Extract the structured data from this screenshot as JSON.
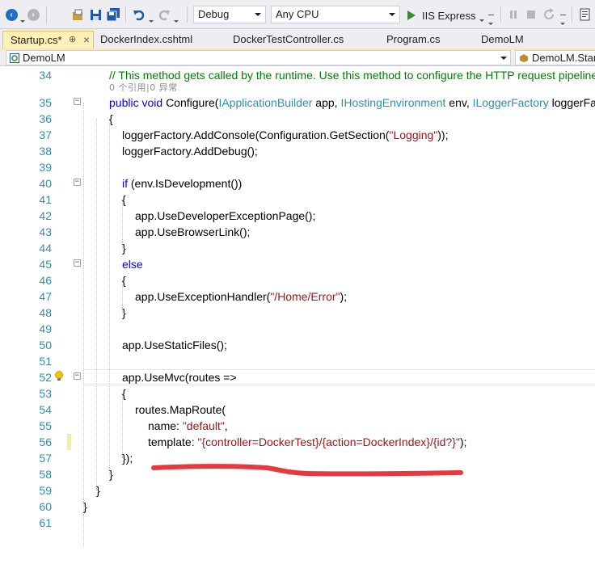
{
  "toolbar": {
    "configuration": "Debug",
    "platform": "Any CPU",
    "run_target": "IIS Express"
  },
  "tabs": [
    {
      "label": "Startup.cs*",
      "pin": "⊕",
      "close": "×",
      "active": true
    },
    {
      "label": "DockerIndex.cshtml",
      "active": false
    },
    {
      "label": "DockerTestController.cs",
      "active": false
    },
    {
      "label": "Program.cs",
      "active": false
    },
    {
      "label": "DemoLM",
      "active": false
    }
  ],
  "navbar": {
    "project": "DemoLM",
    "member": "DemoLM.Startup"
  },
  "editor": {
    "codelens": "0 个引用|0 异常",
    "lines": [
      {
        "n": "34"
      },
      {
        "n": "35"
      },
      {
        "n": "36"
      },
      {
        "n": "37"
      },
      {
        "n": "38"
      },
      {
        "n": "39"
      },
      {
        "n": "40"
      },
      {
        "n": "41"
      },
      {
        "n": "42"
      },
      {
        "n": "43"
      },
      {
        "n": "44"
      },
      {
        "n": "45"
      },
      {
        "n": "46"
      },
      {
        "n": "47"
      },
      {
        "n": "48"
      },
      {
        "n": "49"
      },
      {
        "n": "50"
      },
      {
        "n": "51"
      },
      {
        "n": "52"
      },
      {
        "n": "53"
      },
      {
        "n": "54"
      },
      {
        "n": "55"
      },
      {
        "n": "56"
      },
      {
        "n": "57"
      },
      {
        "n": "58"
      },
      {
        "n": "59"
      },
      {
        "n": "60"
      },
      {
        "n": "61"
      }
    ],
    "code": {
      "l34": "// This method gets called by the runtime. Use this method to configure the HTTP request pipeline.",
      "l35_kw1": "public",
      "l35_kw2": "void",
      "l35_name": "Configure(",
      "l35_t1": "IApplicationBuilder",
      "l35_p1": " app, ",
      "l35_t2": "IHostingEnvironment",
      "l35_p2": " env, ",
      "l35_t3": "ILoggerFactory",
      "l35_p3": " loggerFactory)",
      "l36": "{",
      "l37_a": "loggerFactory.AddConsole(Configuration.GetSection(",
      "l37_s": "\"Logging\"",
      "l37_b": "));",
      "l38": "loggerFactory.AddDebug();",
      "l40_kw": "if",
      "l40_rest": " (env.IsDevelopment())",
      "l41": "{",
      "l42": "app.UseDeveloperExceptionPage();",
      "l43": "app.UseBrowserLink();",
      "l44": "}",
      "l45": "else",
      "l46": "{",
      "l47_a": "app.UseExceptionHandler(",
      "l47_s": "\"/Home/Error\"",
      "l47_b": ");",
      "l48": "}",
      "l50": "app.UseStaticFiles();",
      "l52": "app.UseMvc(routes =>",
      "l53": "{",
      "l54": "routes.MapRoute(",
      "l55_a": "name: ",
      "l55_s": "\"default\"",
      "l55_b": ",",
      "l56_a": "template: ",
      "l56_s": "\"{controller=DockerTest}/{action=DockerIndex}/{id?}\"",
      "l56_b": ");",
      "l57": "});",
      "l58": "}",
      "l59": "}",
      "l60": "}"
    }
  },
  "colors": {
    "keyword": "#0000ff",
    "type": "#2b91af",
    "string": "#a31515",
    "comment": "#008000",
    "line_number": "#2b91af",
    "annotation_underline": "#e8383d",
    "active_tab": "#fff1b7"
  }
}
